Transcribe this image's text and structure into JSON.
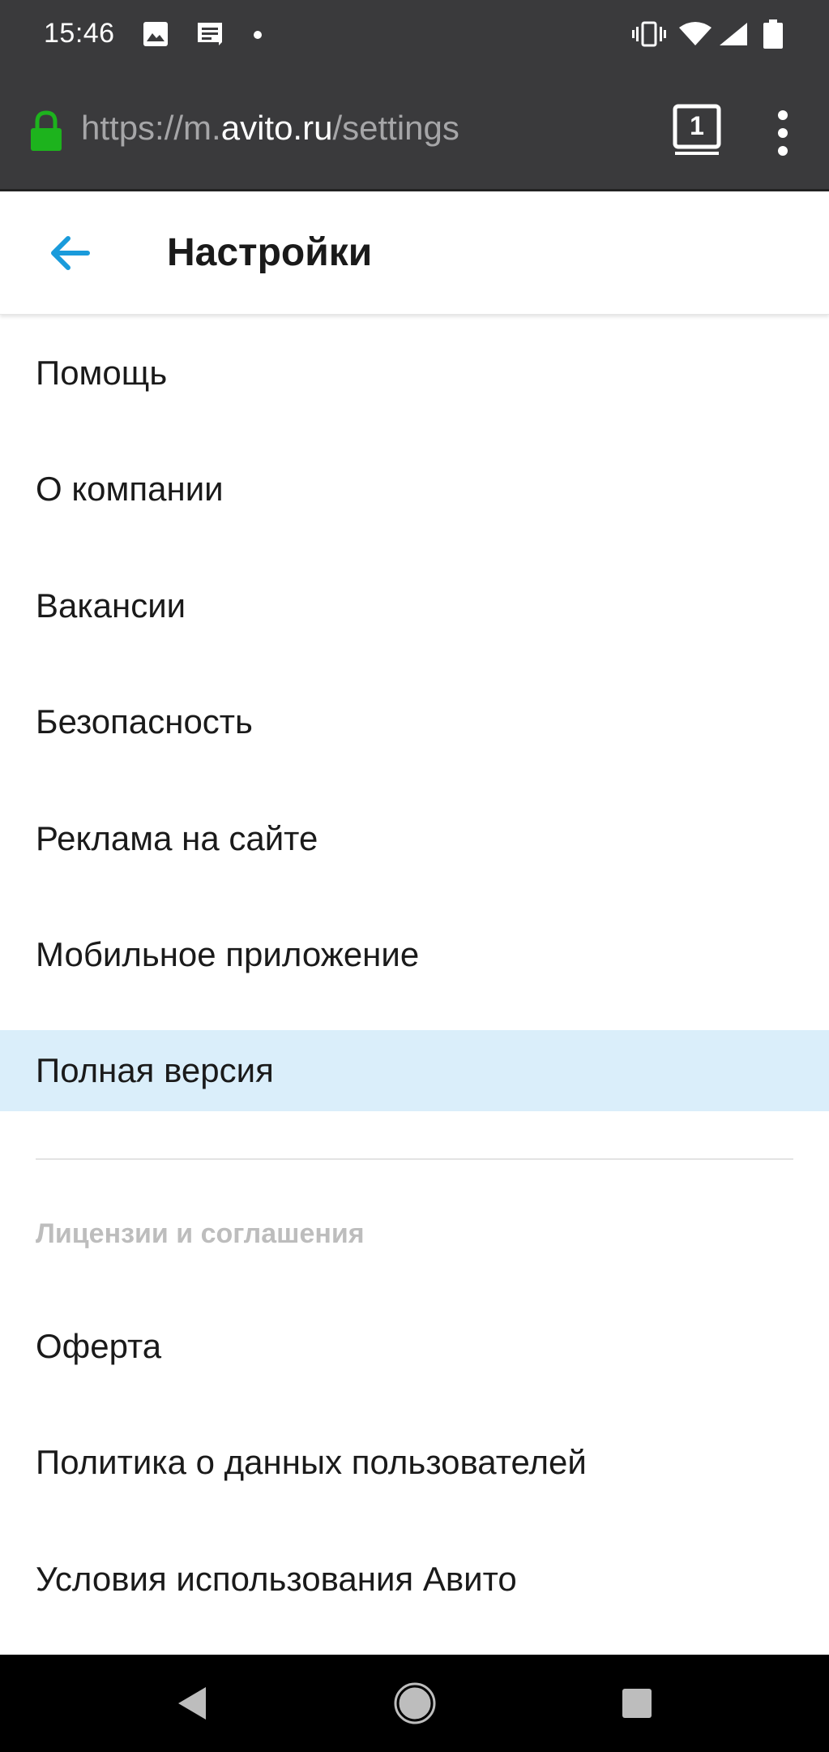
{
  "status_bar": {
    "time": "15:46",
    "icons": [
      "image-icon",
      "message-icon",
      "dot-icon",
      "vibrate-icon",
      "wifi-icon",
      "signal-icon",
      "battery-icon"
    ]
  },
  "browser": {
    "url_prefix": "https://m.",
    "url_host": "avito.ru",
    "url_path": "/settings",
    "tab_count": "1",
    "lock_color": "#1db31d"
  },
  "header": {
    "title": "Настройки",
    "back_color": "#1a9bdb"
  },
  "settings": {
    "items": [
      {
        "label": "Помощь"
      },
      {
        "label": "О компании"
      },
      {
        "label": "Вакансии"
      },
      {
        "label": "Безопасность"
      },
      {
        "label": "Реклама на сайте"
      },
      {
        "label": "Мобильное приложение"
      },
      {
        "label": "Полная версия"
      }
    ],
    "highlight_color": "#daeefa"
  },
  "legal": {
    "section_title": "Лицензии и соглашения",
    "items": [
      {
        "label": "Оферта"
      },
      {
        "label": "Политика о данных пользователей"
      },
      {
        "label": "Условия использования Авито"
      }
    ]
  }
}
